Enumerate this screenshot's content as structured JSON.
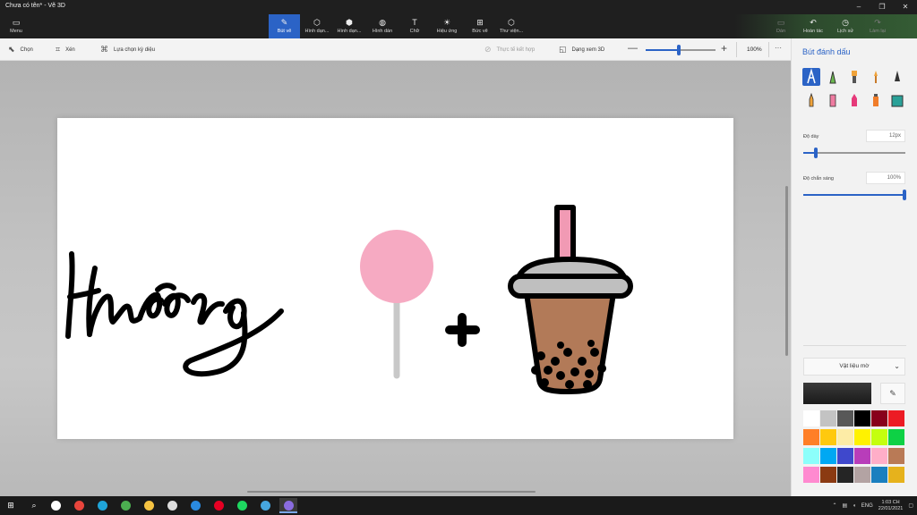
{
  "window": {
    "title": "Chưa có tên* - Vẽ 3D",
    "controls": [
      "–",
      "❐",
      "✕"
    ]
  },
  "ribbon": {
    "menu": "Menu",
    "tools": [
      {
        "label": "Bút vẽ",
        "icon": "brush-icon",
        "glyph": "✎",
        "active": true
      },
      {
        "label": "Hình dạn...",
        "icon": "shapes-2d-icon",
        "glyph": "⬡"
      },
      {
        "label": "Hình dạn...",
        "icon": "shapes-3d-icon",
        "glyph": "⬢"
      },
      {
        "label": "Hình dán",
        "icon": "stickers-icon",
        "glyph": "◍"
      },
      {
        "label": "Chữ",
        "icon": "text-icon",
        "glyph": "T"
      },
      {
        "label": "Hiệu ứng",
        "icon": "effects-icon",
        "glyph": "☀"
      },
      {
        "label": "Bức vẽ",
        "icon": "canvas-icon",
        "glyph": "⊞"
      },
      {
        "label": "Thư viện...",
        "icon": "library-icon",
        "glyph": "⬡"
      }
    ],
    "right": [
      {
        "label": "Dán",
        "icon": "paste-icon",
        "glyph": "▭",
        "dim": true
      },
      {
        "label": "Hoàn tác",
        "icon": "undo-icon",
        "glyph": "↶"
      },
      {
        "label": "Lịch sử",
        "icon": "history-icon",
        "glyph": "◷"
      },
      {
        "label": "Làm lại",
        "icon": "redo-icon",
        "glyph": "↷",
        "dim": true
      }
    ]
  },
  "toolbar": {
    "select": "Chọn",
    "crop": "Xén",
    "magic_select": "Lựa chọn kỳ diệu",
    "mixed_reality": "Thực tế kết hợp",
    "view_3d": "Dạng xem 3D",
    "zoom_minus": "—",
    "zoom_plus": "+",
    "zoom_value": "100%",
    "zoom_percent": 48,
    "more": "···"
  },
  "panel": {
    "title": "Bút đánh dấu",
    "thickness_label": "Độ dày",
    "thickness_value": "12px",
    "thickness_percent": 10,
    "opacity_label": "Độ chắn sáng",
    "opacity_value": "100%",
    "opacity_percent": 100,
    "material": "Vật liệu mờ",
    "material_chevron": "⌄",
    "current_color": "#1f1f1f",
    "eyedropper": "✎",
    "swatches": [
      "#ffffff",
      "#c3c3c3",
      "#585858",
      "#000000",
      "#88001b",
      "#ec1c24",
      "#ff7f27",
      "#ffc90e",
      "#fdeca6",
      "#fff200",
      "#c4ff0e",
      "#0ed145",
      "#8cfffb",
      "#00a8f3",
      "#3f48cc",
      "#b83dba",
      "#ffaec8",
      "#b97a56",
      "#ff8ad0",
      "#8b3a12",
      "#252525",
      "#b3a3a3",
      "#1a7fbf",
      "#e6b21c"
    ]
  },
  "taskbar": {
    "start": "⊞",
    "search": "⌕",
    "apps": [
      {
        "name": "task-view-icon",
        "color": "#ffffff"
      },
      {
        "name": "chrome-icon",
        "color": "#e8453c"
      },
      {
        "name": "edge-icon",
        "color": "#1fa4d8"
      },
      {
        "name": "chrome-2-icon",
        "color": "#4caf50"
      },
      {
        "name": "file-explorer-icon",
        "color": "#f5c342"
      },
      {
        "name": "store-icon",
        "color": "#dddddd"
      },
      {
        "name": "mail-icon",
        "color": "#2a8ae0"
      },
      {
        "name": "pinterest-icon",
        "color": "#e60023"
      },
      {
        "name": "spotify-icon",
        "color": "#1ed760"
      },
      {
        "name": "photos-icon",
        "color": "#46a6e0"
      },
      {
        "name": "paint3d-icon",
        "color": "#8a6ce0"
      }
    ],
    "lang": "ENG",
    "time": "1:03 CH",
    "date": "22/01/2021"
  }
}
